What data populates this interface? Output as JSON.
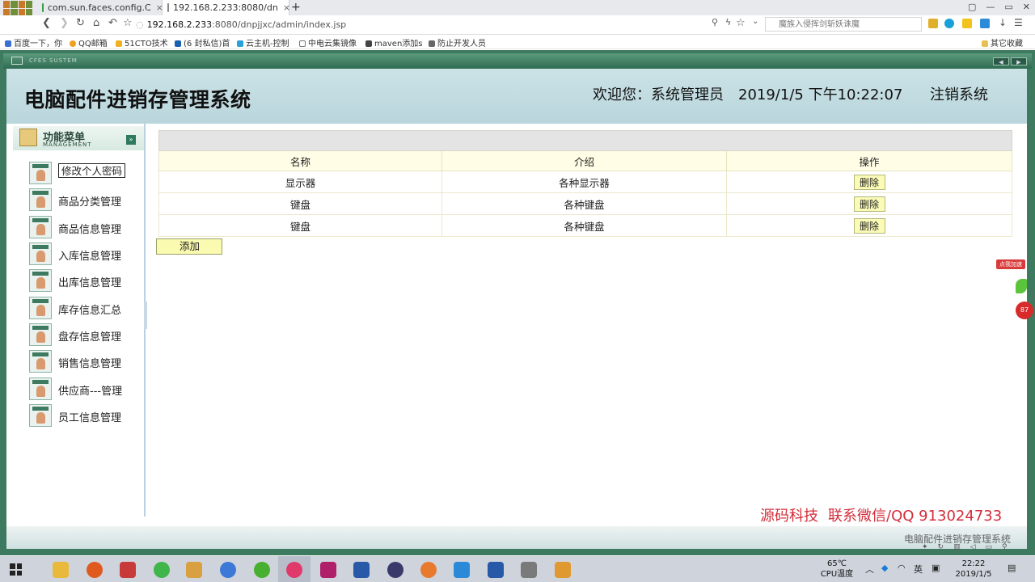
{
  "browser": {
    "tabs": [
      {
        "label": "com.sun.faces.config.C",
        "close": "×"
      },
      {
        "label": "192.168.2.233:8080/dn",
        "close": "×"
      }
    ],
    "new_tab": "+",
    "url_host": "192.168.2.233",
    "url_rest": ":8080/dnpjjxc/admin/index.jsp",
    "search_placeholder": "魔族入侵挥剑斩妖诛魔",
    "bookmarks": [
      "百度一下，你",
      "QQ邮箱",
      "51CTO技术",
      "(6 封私信)首",
      "云主机-控制",
      "中电云集镜像",
      "maven添加s",
      "防止开发人员"
    ],
    "bookmarks_other": "其它收藏"
  },
  "app": {
    "strip_label": "CFES SUSTEM",
    "title": "电脑配件进销存管理系统",
    "welcome": "欢迎您：系统管理员",
    "datetime": "2019/1/5 下午10:22:07",
    "logout": "注销系统",
    "menu": {
      "title": "功能菜单",
      "subtitle": "MANAGEMENT",
      "toggle": "»",
      "items": [
        "修改个人密码",
        "商品分类管理",
        "商品信息管理",
        "入库信息管理",
        "出库信息管理",
        "库存信息汇总",
        "盘存信息管理",
        "销售信息管理",
        "供应商---管理",
        "员工信息管理"
      ]
    },
    "table": {
      "headers": [
        "名称",
        "介绍",
        "操作"
      ],
      "rows": [
        {
          "name": "显示器",
          "desc": "各种显示器",
          "action": "删除"
        },
        {
          "name": "键盘",
          "desc": "各种键盘",
          "action": "删除"
        },
        {
          "name": "键盘",
          "desc": "各种键盘",
          "action": "删除"
        }
      ]
    },
    "add_button": "添加",
    "side_ad": {
      "tag": "点我加速",
      "badge": "87"
    },
    "footer": "电脑配件进销存管理系统"
  },
  "watermark": {
    "brand": "源码科技",
    "contact": "联系微信/QQ 913024733"
  },
  "taskbar": {
    "temp": "65℃",
    "temp_label": "CPU温度",
    "ime": "英",
    "time": "22:22",
    "date": "2019/1/5"
  }
}
